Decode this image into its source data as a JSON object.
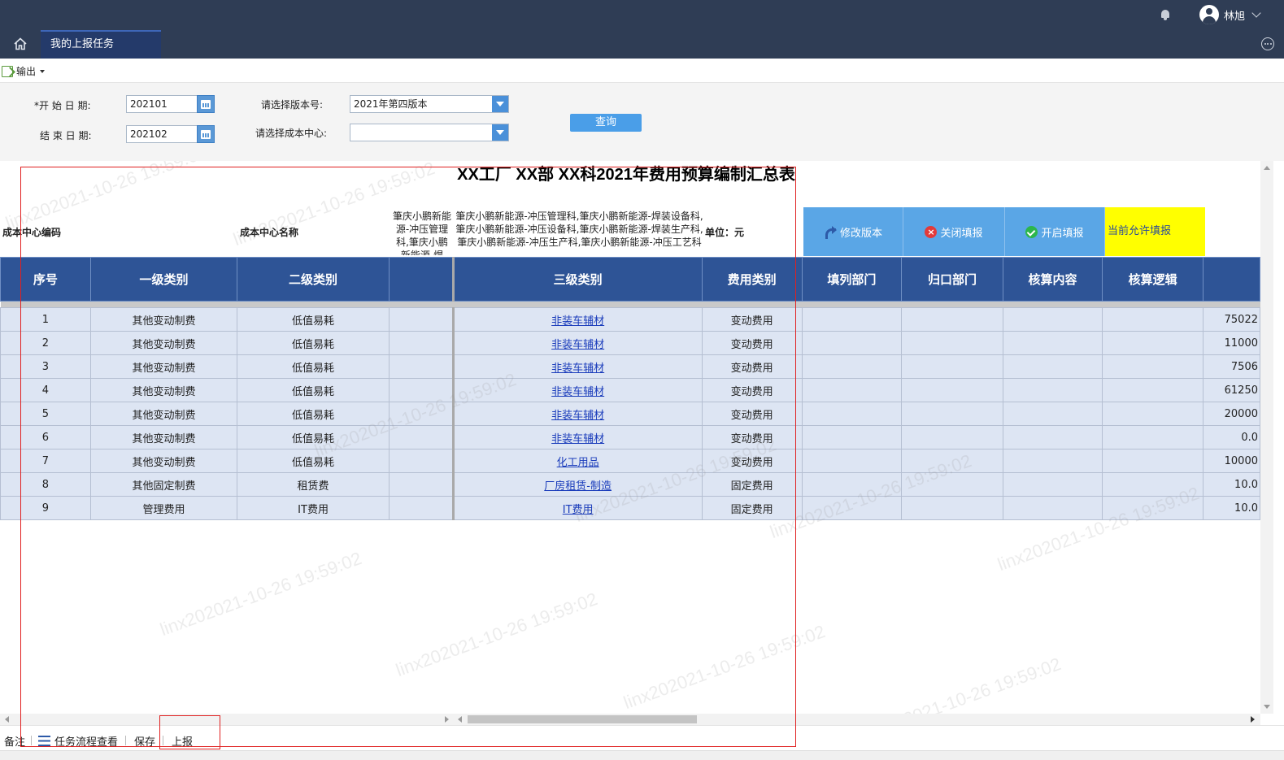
{
  "header": {
    "user_name": "林旭",
    "active_tab": "我的上报任务"
  },
  "toolbar": {
    "export_label": "输出"
  },
  "query": {
    "start_label": "*开 始 日 期:",
    "start_value": "202101",
    "end_label": "结 束 日 期:",
    "end_value": "202102",
    "version_label": "请选择版本号:",
    "version_value": "2021年第四版本",
    "cost_center_label": "请选择成本中心:",
    "cost_center_value": "",
    "query_button": "查询"
  },
  "report": {
    "title": "XX工厂 XX部 XX科2021年费用预算编制汇总表",
    "cost_code_label": "成本中心编码",
    "cost_name_label": "成本中心名称",
    "cost_name_value": "筆庆小鹏新能源-冲压管理科,筆庆小鹏新能源-焊",
    "cost_detail_value": "筆庆小鹏新能源-冲压管理科,筆庆小鹏新能源-焊装设备科,筆庆小鹏新能源-冲压设备科,筆庆小鹏新能源-焊装生产科,筆庆小鹏新能源-冲压生产科,筆庆小鹏新能源-冲压工艺科",
    "unit_label": "单位：元",
    "buttons": {
      "edit_version": "修改版本",
      "close_fill": "关闭填报",
      "open_fill": "开启填报",
      "allow_fill": "当前允许填报"
    },
    "columns": [
      "序号",
      "一级类别",
      "二级类别",
      "",
      "三级类别",
      "费用类别",
      "填列部门",
      "归口部门",
      "核算内容",
      "核算逻辑",
      ""
    ],
    "rows": [
      {
        "no": "1",
        "c1": "其他变动制费",
        "c2": "低值易耗",
        "c3": "非装车辅材",
        "c4": "变动费用",
        "val": "75022"
      },
      {
        "no": "2",
        "c1": "其他变动制费",
        "c2": "低值易耗",
        "c3": "非装车辅材",
        "c4": "变动费用",
        "val": "11000"
      },
      {
        "no": "3",
        "c1": "其他变动制费",
        "c2": "低值易耗",
        "c3": "非装车辅材",
        "c4": "变动费用",
        "val": "7506"
      },
      {
        "no": "4",
        "c1": "其他变动制费",
        "c2": "低值易耗",
        "c3": "非装车辅材",
        "c4": "变动费用",
        "val": "61250"
      },
      {
        "no": "5",
        "c1": "其他变动制费",
        "c2": "低值易耗",
        "c3": "非装车辅材",
        "c4": "变动费用",
        "val": "20000"
      },
      {
        "no": "6",
        "c1": "其他变动制费",
        "c2": "低值易耗",
        "c3": "非装车辅材",
        "c4": "变动费用",
        "val": "0.0"
      },
      {
        "no": "7",
        "c1": "其他变动制费",
        "c2": "低值易耗",
        "c3": "化工用品",
        "c4": "变动费用",
        "val": "10000"
      },
      {
        "no": "8",
        "c1": "其他固定制费",
        "c2": "租赁费",
        "c3": "厂房租赁-制造",
        "c4": "固定费用",
        "val": "10.0"
      },
      {
        "no": "9",
        "c1": "管理费用",
        "c2": "IT费用",
        "c3": "IT费用",
        "c4": "固定费用",
        "val": "10.0"
      }
    ]
  },
  "footer": {
    "remark": "备注",
    "flow": "任务流程查看",
    "save": "保存",
    "submit": "上报"
  },
  "watermark": "linx202021-10-26 19:59:02"
}
